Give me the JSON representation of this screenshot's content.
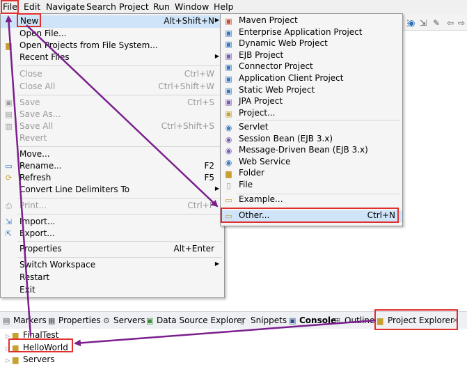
{
  "menubar": [
    "File",
    "Edit",
    "Navigate",
    "Search",
    "Project",
    "Run",
    "Window",
    "Help"
  ],
  "file_menu": {
    "new": {
      "label": "New",
      "shortcut": "Alt+Shift+N"
    },
    "open_file": "Open File...",
    "open_projects": "Open Projects from File System...",
    "recent_files": "Recent Files",
    "close": {
      "label": "Close",
      "shortcut": "Ctrl+W"
    },
    "close_all": {
      "label": "Close All",
      "shortcut": "Ctrl+Shift+W"
    },
    "save": {
      "label": "Save",
      "shortcut": "Ctrl+S"
    },
    "save_as": "Save As...",
    "save_all": {
      "label": "Save All",
      "shortcut": "Ctrl+Shift+S"
    },
    "revert": "Revert",
    "move": "Move...",
    "rename": {
      "label": "Rename...",
      "shortcut": "F2"
    },
    "refresh": {
      "label": "Refresh",
      "shortcut": "F5"
    },
    "convert": "Convert Line Delimiters To",
    "print": {
      "label": "Print...",
      "shortcut": "Ctrl+P"
    },
    "import": "Import...",
    "export": "Export...",
    "properties": {
      "label": "Properties",
      "shortcut": "Alt+Enter"
    },
    "switch_workspace": "Switch Workspace",
    "restart": "Restart",
    "exit": "Exit"
  },
  "new_menu": {
    "items_top": [
      "Maven Project",
      "Enterprise Application Project",
      "Dynamic Web Project",
      "EJB Project",
      "Connector Project",
      "Application Client Project",
      "Static Web Project",
      "JPA Project",
      "Project..."
    ],
    "items_mid": [
      "Servlet",
      "Session Bean (EJB 3.x)",
      "Message-Driven Bean (EJB 3.x)",
      "Web Service",
      "Folder",
      "File"
    ],
    "example": "Example...",
    "other": {
      "label": "Other...",
      "shortcut": "Ctrl+N"
    }
  },
  "views_tabs": [
    "Markers",
    "Properties",
    "Servers",
    "Data Source Explorer",
    "Snippets",
    "Console",
    "Outline",
    "Project Explorer"
  ],
  "tree": [
    "FinalTest",
    "HelloWorld",
    "Servers"
  ],
  "colors": {
    "highlight_red": "#e0302e",
    "arrow_purple": "#7a1f8c"
  }
}
